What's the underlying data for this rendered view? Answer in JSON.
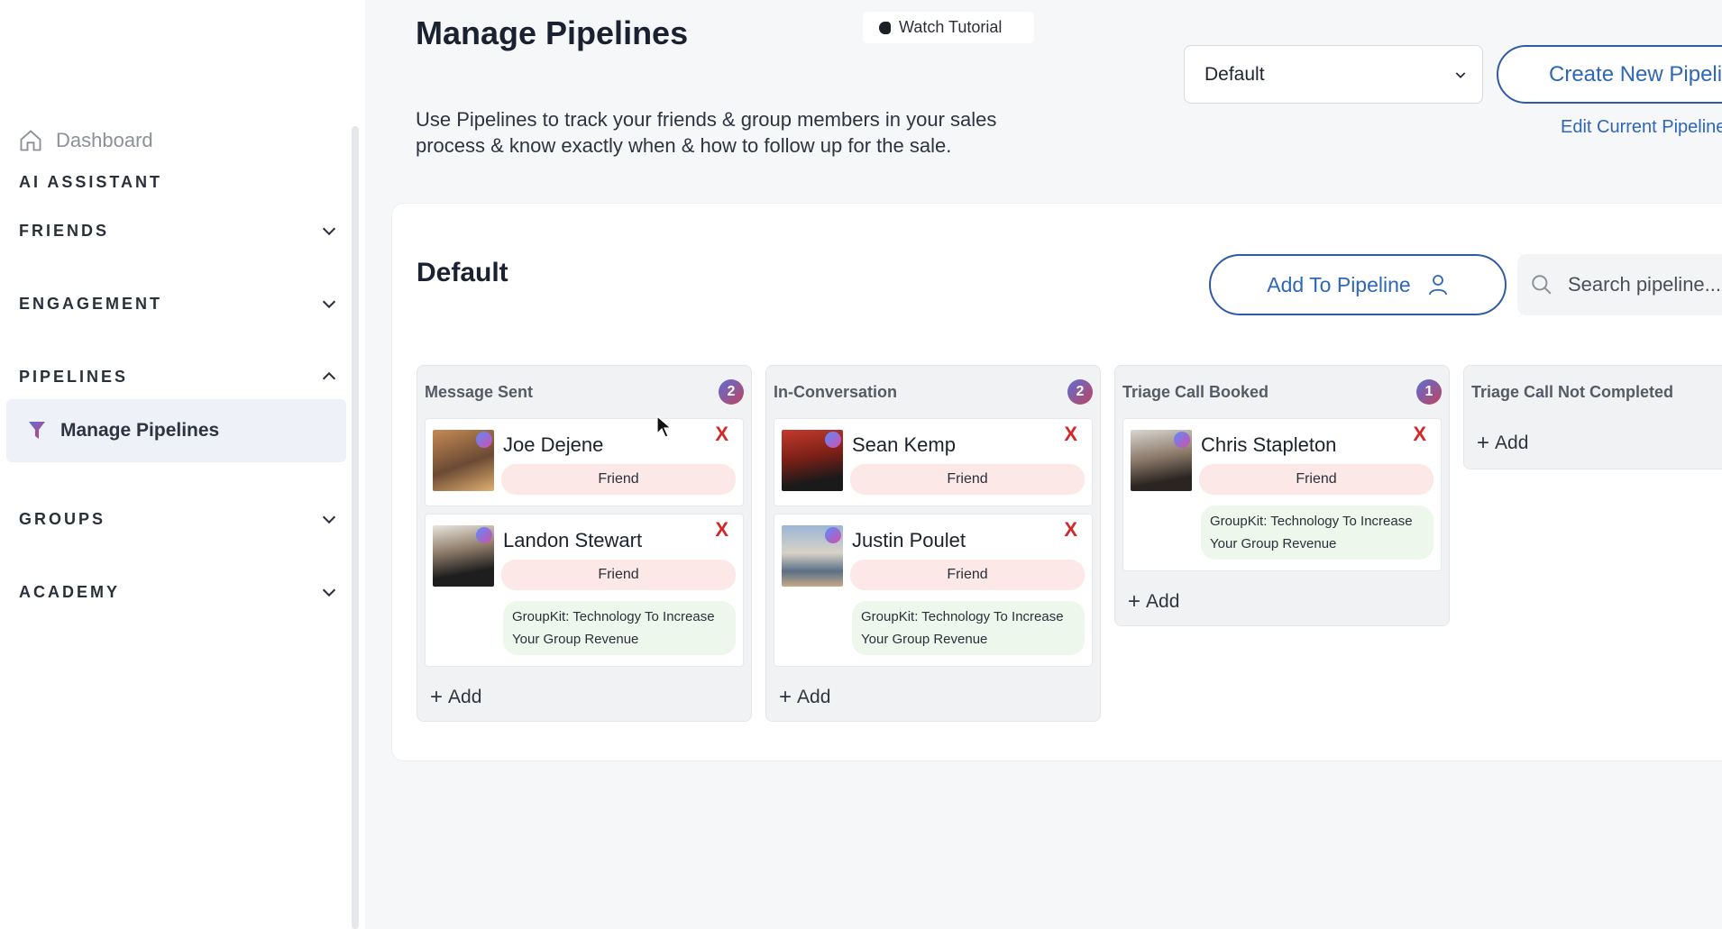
{
  "sidebar": {
    "dashboard": "Dashboard",
    "sections": {
      "ai_assistant": "AI ASSISTANT",
      "friends": "FRIENDS",
      "engagement": "ENGAGEMENT",
      "pipelines": "PIPELINES",
      "groups": "GROUPS",
      "academy": "ACADEMY"
    },
    "active_item": "Manage Pipelines"
  },
  "header": {
    "title": "Manage Pipelines",
    "watch_tutorial": "Watch Tutorial",
    "description": "Use Pipelines to track your friends & group members in your sales process & know exactly when & how to follow up for the sale.",
    "pipeline_select": "Default",
    "create_button": "Create New Pipeline",
    "edit_link": "Edit Current Pipeline"
  },
  "board": {
    "title": "Default",
    "add_to_pipeline": "Add To Pipeline",
    "search_placeholder": "Search pipeline...",
    "add_label": "Add",
    "columns": [
      {
        "title": "Message Sent",
        "count": "2",
        "cards": [
          {
            "name": "Joe Dejene",
            "tag": "Friend",
            "remove": "X"
          },
          {
            "name": "Landon Stewart",
            "tag": "Friend",
            "group": "GroupKit: Technology To Increase Your Group Revenue",
            "remove": "X"
          }
        ]
      },
      {
        "title": "In-Conversation",
        "count": "2",
        "cards": [
          {
            "name": "Sean Kemp",
            "tag": "Friend",
            "remove": "X"
          },
          {
            "name": "Justin Poulet",
            "tag": "Friend",
            "group": "GroupKit: Technology To Increase Your Group Revenue",
            "remove": "X"
          }
        ]
      },
      {
        "title": "Triage Call Booked",
        "count": "1",
        "cards": [
          {
            "name": "Chris Stapleton",
            "tag": "Friend",
            "group": "GroupKit: Technology To Increase Your Group Revenue",
            "remove": "X"
          }
        ]
      },
      {
        "title": "Triage Call Not Completed",
        "count": "",
        "cards": []
      }
    ]
  },
  "colors": {
    "accent": "#2e66b8",
    "remove": "#d22828",
    "friend_tag": "#fde8e8",
    "group_tag": "#eef7ec"
  }
}
